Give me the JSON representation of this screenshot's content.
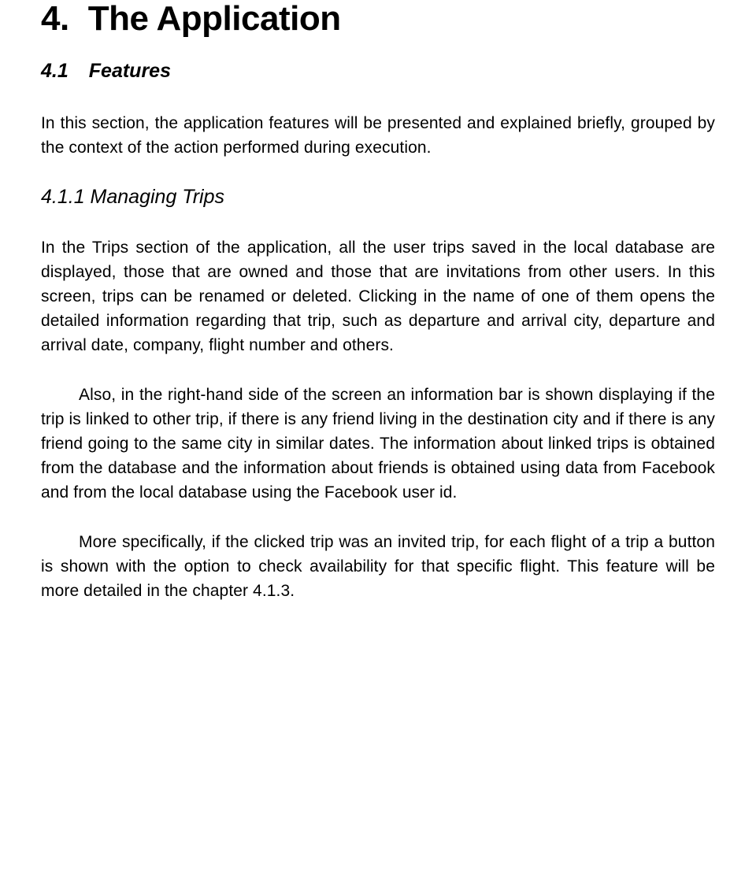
{
  "chapter": {
    "number": "4.",
    "title": "The Application"
  },
  "section": {
    "number": "4.1",
    "title": "Features",
    "intro": "In this section, the application features will be presented and explained briefly, grouped by the context of the action performed during execution."
  },
  "subsection": {
    "title": "4.1.1 Managing Trips",
    "paragraphs": [
      "In the Trips section of the application, all the user trips saved in the local database are displayed, those that are owned and those that are invitations from other users. In this screen, trips can be renamed or deleted. Clicking in the name of one of them opens the detailed information regarding that trip, such as departure and arrival city, departure and arrival date, company, flight number and others.",
      "Also, in the right-hand side of the screen an information bar is shown displaying if the trip is linked to other trip, if there is any friend living in the destination city and if there is any friend going to the same city in similar dates. The information about linked trips is obtained from the database and the information about friends is obtained using data from Facebook and from the local database using the Facebook user id.",
      "More specifically, if the clicked trip was an invited trip, for each flight of a trip a button is shown with the option to check availability for that specific flight. This feature will be more detailed in the chapter 4.1.3."
    ]
  }
}
